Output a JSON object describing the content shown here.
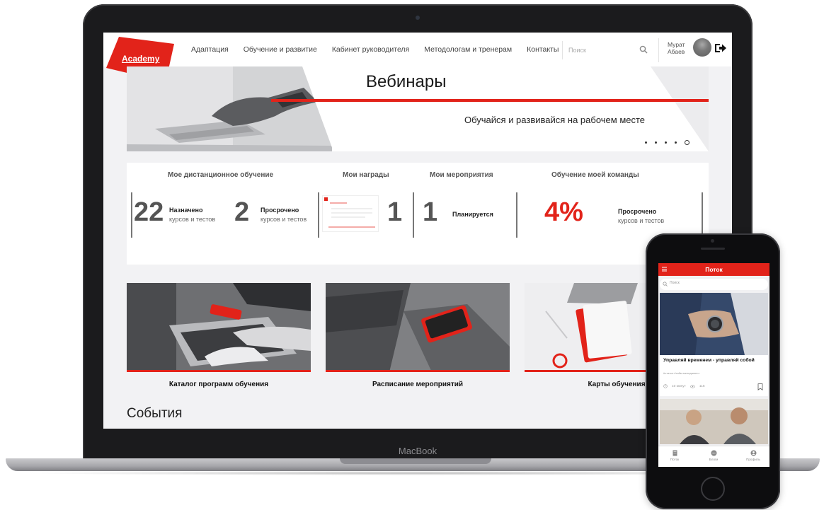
{
  "site": {
    "logo": "Academy",
    "nav": [
      "Адаптация",
      "Обучение и развитие",
      "Кабинет руководителя",
      "Методологам и тренерам",
      "Контакты"
    ],
    "search_placeholder": "Поиск",
    "user": {
      "first_name": "Мурат",
      "last_name": "Абаев"
    }
  },
  "hero": {
    "title": "Вебинары",
    "subtitle": "Обучайся и развивайся на рабочем месте",
    "slide_count": 5,
    "active_slide": 5
  },
  "stats": {
    "distance": {
      "heading": "Мое дистанционное обучение",
      "assigned": {
        "value": "22",
        "label": "Назначено",
        "sub": "курсов и тестов"
      },
      "overdue": {
        "value": "2",
        "label": "Просрочено",
        "sub": "курсов и тестов"
      }
    },
    "awards": {
      "heading": "Мои награды",
      "value": "1"
    },
    "events": {
      "heading": "Мои мероприятия",
      "value": "1",
      "label": "Планируется"
    },
    "team": {
      "heading": "Обучение моей команды",
      "value": "4%",
      "label": "Просрочено",
      "sub": "курсов и тестов"
    }
  },
  "tiles": [
    {
      "caption": "Каталог программ обучения"
    },
    {
      "caption": "Расписание мероприятий"
    },
    {
      "caption": "Карты обучения"
    }
  ],
  "events_section": {
    "title": "События"
  },
  "laptop_brand": "MacBook",
  "phone": {
    "title": "Поток",
    "search_placeholder": "Поиск",
    "card": {
      "title": "Управляй временем - управляй собой",
      "tags": "#статьи   #тайм-менеджмент",
      "duration": "10 минут",
      "views": "115"
    },
    "tabs": [
      "Поток",
      "Блоги",
      "Профиль"
    ]
  },
  "colors": {
    "accent": "#e2231a",
    "screen_bg": "#f2f2f4",
    "device": "#1b1b1d"
  }
}
